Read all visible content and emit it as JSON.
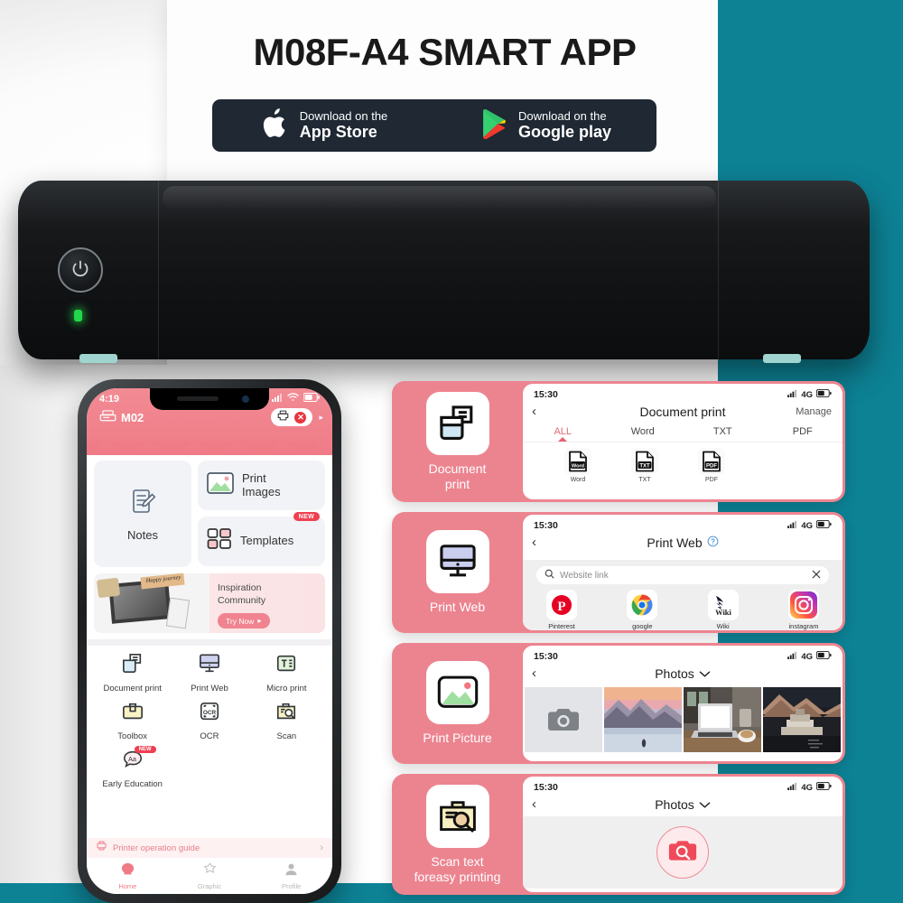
{
  "promo": {
    "title": "M08F-A4 SMART APP",
    "stores": [
      {
        "icon": "apple-icon",
        "line1": "Download on the",
        "line2": "App Store"
      },
      {
        "icon": "google-play-icon",
        "line1": "Download on the",
        "line2": "Google play"
      }
    ]
  },
  "colors": {
    "teal_background": "#0d8295",
    "card_pink": "#ec8490",
    "header_pink": "#ef7b86",
    "accent_red": "#ef4050",
    "store_bar": "#1f2833",
    "printer_black": "#17191b",
    "led_green": "#22d84a"
  },
  "printer": {
    "power_icon": "power-icon",
    "led_status": "led-indicator"
  },
  "phone": {
    "status": {
      "time": "4:19",
      "signal": "signal-icon",
      "wifi": "wifi-icon",
      "battery": "battery-icon"
    },
    "printer_name": "M02",
    "printer_icon": "printer-icon",
    "chip": {
      "print_icon": "print-icon",
      "disconnect_icon": "close-icon",
      "arrow": "▸"
    },
    "tiles": {
      "notes": {
        "label": "Notes",
        "icon": "notes-icon"
      },
      "print_images": {
        "label": "Print\nImages",
        "line1": "Print",
        "line2": "Images",
        "icon": "image-icon"
      },
      "templates": {
        "label": "Templates",
        "icon": "templates-icon",
        "badge": "NEW"
      }
    },
    "banner": {
      "title_line1": "Inspiration",
      "title_line2": "Community",
      "button": "Try Now",
      "button_arrow": "▸",
      "art_caption": "Happy journey"
    },
    "grid": [
      {
        "label": "Document print",
        "icon": "document-print-icon"
      },
      {
        "label": "Print Web",
        "icon": "monitor-icon"
      },
      {
        "label": "Micro print",
        "icon": "micro-print-icon"
      },
      {
        "label": "Toolbox",
        "icon": "toolbox-icon"
      },
      {
        "label": "OCR",
        "icon": "ocr-icon"
      },
      {
        "label": "Scan",
        "icon": "scan-icon"
      },
      {
        "label": "Early Education",
        "icon": "early-education-icon",
        "badge": "NEW"
      }
    ],
    "guide": {
      "label": "Printer operation guide",
      "icon": "guide-icon",
      "arrow": "›"
    },
    "tabbar": [
      {
        "label": "Home",
        "icon": "home-icon",
        "active": true
      },
      {
        "label": "Graphic",
        "icon": "graphic-icon",
        "active": false
      },
      {
        "label": "Profile",
        "icon": "profile-icon",
        "active": false
      }
    ]
  },
  "cards": [
    {
      "caption_line1": "Document",
      "caption_line2": "print",
      "icon": "document-print-icon",
      "status": {
        "time": "15:30",
        "network": "4G",
        "signal": "signal-icon",
        "battery": "battery-icon"
      },
      "nav": {
        "back": "‹",
        "title": "Document print",
        "action": "Manage"
      },
      "tabs": [
        "ALL",
        "Word",
        "TXT",
        "PDF"
      ],
      "active_tab": "ALL",
      "filetypes": [
        {
          "badge": "Word",
          "label": "Word"
        },
        {
          "badge": "TXT",
          "label": "TXT"
        },
        {
          "badge": "PDF",
          "label": "PDF"
        }
      ]
    },
    {
      "caption_line1": "Print Web",
      "caption_line2": "",
      "icon": "monitor-icon",
      "status": {
        "time": "15:30",
        "network": "4G",
        "signal": "signal-icon",
        "battery": "battery-icon"
      },
      "nav": {
        "back": "‹",
        "title": "Print Web",
        "help_icon": "help-icon"
      },
      "search": {
        "placeholder": "Website link",
        "search_icon": "search-icon",
        "clear_icon": "close-icon"
      },
      "sites": [
        {
          "label": "Pinterest",
          "icon": "pinterest-icon"
        },
        {
          "label": "google",
          "icon": "chrome-icon"
        },
        {
          "label": "Wiki",
          "icon": "wikipedia-icon"
        },
        {
          "label": "instagram",
          "icon": "instagram-icon"
        }
      ]
    },
    {
      "caption_line1": "Print Picture",
      "caption_line2": "",
      "icon": "image-icon",
      "status": {
        "time": "15:30",
        "network": "4G",
        "signal": "signal-icon",
        "battery": "battery-icon"
      },
      "nav": {
        "back": "‹",
        "title": "Photos",
        "chevron": "chevron-down-icon"
      },
      "photos": [
        "camera-tile",
        "mountain-lake-photo",
        "laptop-desk-photo",
        "palace-mountain-photo"
      ]
    },
    {
      "caption_line1": "Scan text",
      "caption_line2": "foreasy printing",
      "icon": "scan-text-icon",
      "status": {
        "time": "15:30",
        "network": "4G",
        "signal": "signal-icon",
        "battery": "battery-icon"
      },
      "nav": {
        "back": "‹",
        "title": "Photos",
        "chevron": "chevron-down-icon"
      },
      "scan_button_icon": "scan-camera-icon"
    }
  ]
}
